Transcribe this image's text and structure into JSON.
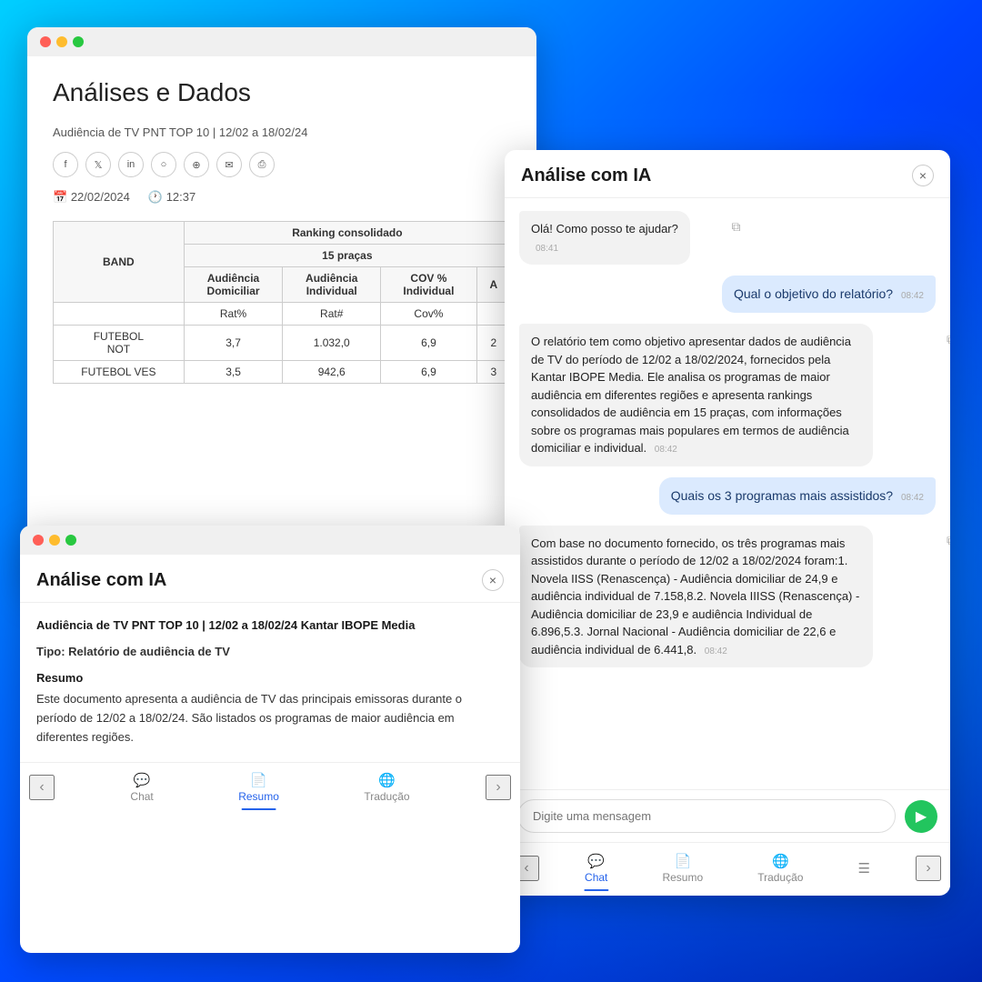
{
  "windows": {
    "main": {
      "title": "Análises e Dados",
      "article_subtitle": "Audiência de TV PNT TOP 10 | 12/02 a 18/02/24",
      "date": "22/02/2024",
      "time": "12:37",
      "table": {
        "col1_header": "BAND",
        "col2_header": "Ranking consolidado",
        "sub_header": "15  praças",
        "row_headers": [
          "Audiência Domiciliar",
          "Audiência Individual",
          "COV % Individual"
        ],
        "sub_row_headers": [
          "Rat%",
          "Rat#",
          "Cov%"
        ],
        "rows": [
          {
            "program": "FUTEBOL NOT",
            "rat_pct": "3,7",
            "rat_hash": "1.032,0",
            "cov": "6,9"
          },
          {
            "program": "FUTEBOL VES",
            "rat_pct": "3,5",
            "rat_hash": "942,6",
            "cov": "6,9"
          }
        ]
      }
    },
    "chat_right": {
      "title": "Análise com IA",
      "messages": [
        {
          "type": "bot",
          "text": "Olá! Como posso te ajudar?",
          "time": "08:41"
        },
        {
          "type": "user",
          "text": "Qual o objetivo do relatório?",
          "time": "08:42"
        },
        {
          "type": "bot",
          "text": "O relatório tem como objetivo apresentar dados de audiência de TV do período de 12/02 a 18/02/2024, fornecidos pela Kantar IBOPE Media. Ele analisa os programas de maior audiência em diferentes regiões e apresenta rankings consolidados de audiência em 15 praças, com informações sobre os programas mais populares em termos de audiência domiciliar e individual.",
          "time": "08:42"
        },
        {
          "type": "user",
          "text": "Quais os 3 programas mais assistidos?",
          "time": "08:42"
        },
        {
          "type": "bot",
          "text": "Com base no documento fornecido, os três programas mais assistidos durante o período de 12/02 a 18/02/2024 foram:1. Novela IISS (Renascença) - Audiência domiciliar de 24,9 e audiência individual de 7.158,8.2. Novela IIISS (Renascença) - Audiência domiciliar de 23,9 e audiência Individual de 6.896,5.3. Jornal Nacional - Audiência domiciliar de 22,6 e audiência individual de 6.441,8.",
          "time": "08:42"
        }
      ],
      "input_placeholder": "Digite uma mensagem",
      "tabs": [
        {
          "label": "Chat",
          "icon": "💬",
          "active": true
        },
        {
          "label": "Resumo",
          "icon": "📄",
          "active": false
        },
        {
          "label": "Tradução",
          "icon": "🌐",
          "active": false
        }
      ]
    },
    "chat_left": {
      "title": "Análise com IA",
      "doc_title": "Audiência de TV PNT TOP 10 | 12/02 a 18/02/24 Kantar IBOPE Media",
      "doc_type_label": "Tipo:",
      "doc_type_value": "Relatório de audiência de TV",
      "doc_resumo_label": "Resumo",
      "doc_resumo_text": "Este documento apresenta a audiência de TV das principais emissoras durante o período de 12/02 a 18/02/24. São listados os programas de maior audiência em diferentes regiões.",
      "tabs": [
        {
          "label": "Chat",
          "icon": "💬",
          "active": false
        },
        {
          "label": "Resumo",
          "icon": "📄",
          "active": true
        },
        {
          "label": "Tradução",
          "icon": "🌐",
          "active": false
        }
      ]
    }
  },
  "icons": {
    "close": "×",
    "send": "▶",
    "copy": "⧉",
    "prev": "‹",
    "next": "›",
    "calendar": "📅",
    "clock": "🕐"
  },
  "social": [
    "f",
    "t",
    "in",
    "○",
    "w",
    "✉",
    "🖶"
  ]
}
